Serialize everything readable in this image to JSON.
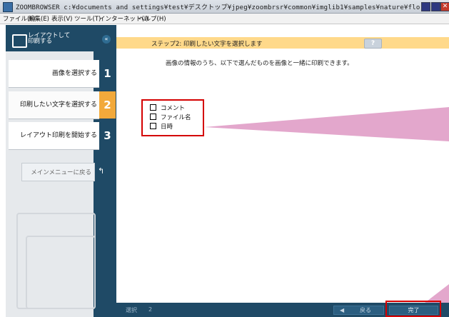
{
  "window": {
    "title": "ZOOMBROWSER c:¥documents and settings¥test¥デスクトップ¥jpeg¥zoombrsr¥common¥imglib1¥samples¥nature¥flo...",
    "close_glyph": "✕"
  },
  "menu": [
    "ファイル(F)",
    "編集(E)",
    "表示(V)",
    "ツール(T)",
    "インターネット(I)",
    "ヘルプ(H)"
  ],
  "sidebar": {
    "header_label": "レイアウトして\n印刷する",
    "collapse_glyph": "«",
    "steps": [
      {
        "label": "画像を選択する",
        "num": "1"
      },
      {
        "label": "印刷したい文字を選択する",
        "num": "2",
        "active": true
      },
      {
        "label": "レイアウト印刷を開始する",
        "num": "3"
      }
    ],
    "menu_button": "メインメニューに戻る",
    "menu_button_icon": "↰"
  },
  "main": {
    "banner": "ステップ2: 印刷したい文字を選択します",
    "help_button": "?",
    "description": "画像の情報のうち、以下で選んだものを画像と一緒に印刷できます。",
    "options": [
      {
        "label": "コメント",
        "checked": false
      },
      {
        "label": "ファイル名",
        "checked": false
      },
      {
        "label": "日時",
        "checked": false
      }
    ]
  },
  "statusbar": {
    "select_label": "選択",
    "select_count": "2",
    "back_arrow": "◀",
    "back_label": "戻る",
    "done_label": "完了"
  },
  "colors": {
    "sidebar_navy": "#1f4a66",
    "active_step_orange": "#f2a93b",
    "banner_yellow": "#ffd98a",
    "highlight_red": "#d40000",
    "wedge_pink": "#e3a7cc"
  }
}
